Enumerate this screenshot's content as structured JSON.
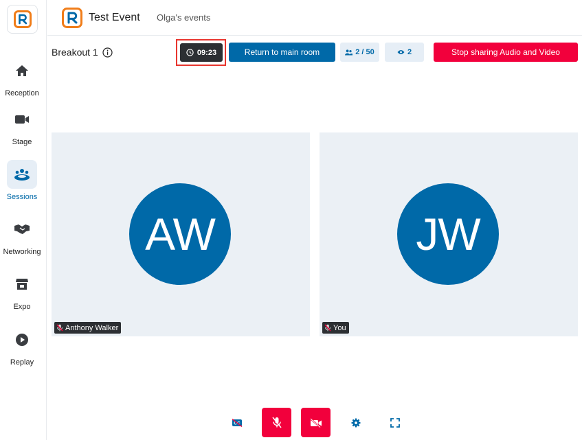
{
  "colors": {
    "brand_blue": "#0069a8",
    "brand_orange": "#f07d19",
    "stop_red": "#f2003c",
    "timer_dark": "#2c2f33",
    "tile_bg": "#ebf0f5"
  },
  "header": {
    "event_title": "Test Event",
    "event_owner": "Olga's events"
  },
  "sidebar": {
    "items": [
      {
        "label": "Reception",
        "icon": "home-icon"
      },
      {
        "label": "Stage",
        "icon": "video-camera-icon"
      },
      {
        "label": "Sessions",
        "icon": "people-group-icon",
        "active": true
      },
      {
        "label": "Networking",
        "icon": "handshake-icon"
      },
      {
        "label": "Expo",
        "icon": "booth-icon"
      },
      {
        "label": "Replay",
        "icon": "play-circle-icon"
      }
    ]
  },
  "room": {
    "title": "Breakout 1",
    "timer": "09:23",
    "return_label": "Return to main room",
    "participants": "2 / 50",
    "viewers": "2",
    "stop_label": "Stop sharing Audio and Video"
  },
  "participants": [
    {
      "initials": "AW",
      "name": "Anthony Walker",
      "muted": true
    },
    {
      "initials": "JW",
      "name": "You",
      "muted": true
    }
  ],
  "controls": [
    {
      "name": "captions-off",
      "icon": "closed-captions-off-icon"
    },
    {
      "name": "microphone-off",
      "icon": "mic-off-icon"
    },
    {
      "name": "camera-off",
      "icon": "camera-off-icon"
    },
    {
      "name": "settings",
      "icon": "gear-icon"
    },
    {
      "name": "fullscreen",
      "icon": "fullscreen-icon"
    }
  ]
}
